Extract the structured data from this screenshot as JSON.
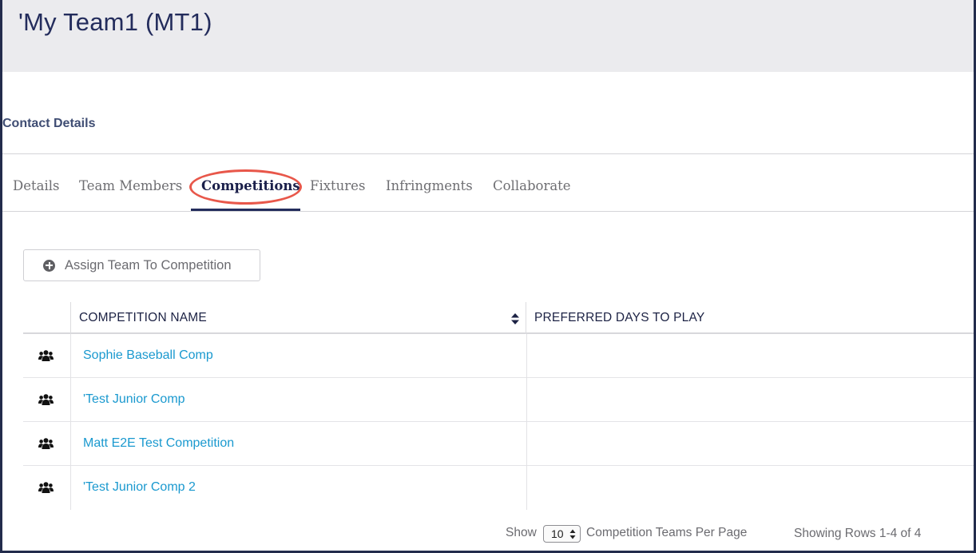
{
  "header": {
    "title": "'My Team1 (MT1)"
  },
  "section": {
    "contact_details": "Contact Details"
  },
  "tabs": [
    {
      "label": "Details",
      "active": false
    },
    {
      "label": "Team Members",
      "active": false
    },
    {
      "label": "Competitions",
      "active": true
    },
    {
      "label": "Fixtures",
      "active": false
    },
    {
      "label": "Infringments",
      "active": false
    },
    {
      "label": "Collaborate",
      "active": false
    }
  ],
  "actions": {
    "assign_label": "Assign Team To Competition",
    "assign_icon": "plus-circle-icon"
  },
  "table": {
    "columns": [
      "COMPETITION NAME",
      "PREFERRED DAYS TO PLAY"
    ],
    "row_icon": "users-group-icon",
    "rows": [
      {
        "name": "Sophie Baseball Comp",
        "preferred_days": ""
      },
      {
        "name": "'Test Junior Comp",
        "preferred_days": ""
      },
      {
        "name": "Matt E2E Test Competition",
        "preferred_days": ""
      },
      {
        "name": "'Test Junior Comp 2",
        "preferred_days": ""
      }
    ]
  },
  "pagination": {
    "show_label": "Show",
    "per_page_value": "10",
    "per_page_label": "Competition Teams Per Page",
    "showing_text": "Showing Rows 1-4 of 4"
  },
  "colors": {
    "link": "#1a99cf",
    "header_band": "#ebebee",
    "highlight_circle": "#e8574a",
    "title": "#232c5c"
  }
}
